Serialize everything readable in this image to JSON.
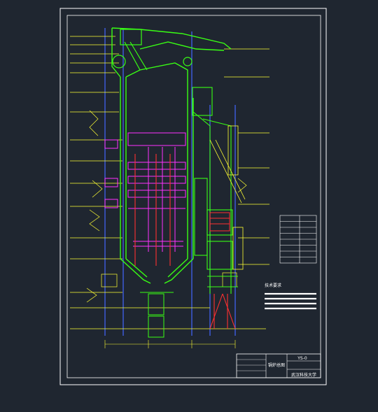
{
  "colors": {
    "background": "#1f2630",
    "frame": "#ffffff",
    "structure_green": "#39ff14",
    "steel_yellow": "#ffff33",
    "tube_magenta": "#ff33ff",
    "column_blue": "#4466ff",
    "pipe_red": "#ff3030",
    "table_white": "#ffffff"
  },
  "title_block": {
    "drawing_number": "YS-0",
    "sheet_title": "锅炉总图",
    "university": "武汉科技大学"
  },
  "notes_heading": "技术要求",
  "spec_table": {
    "rows": 8
  }
}
